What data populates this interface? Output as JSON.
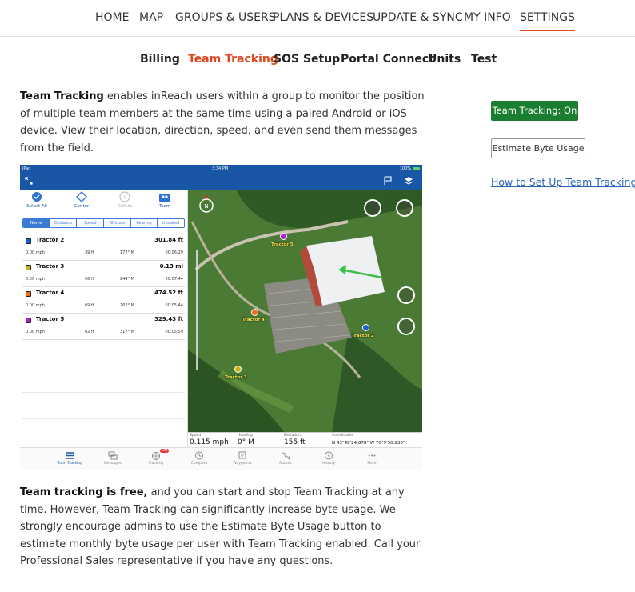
{
  "top_nav": {
    "items": [
      "HOME",
      "MAP",
      "GROUPS & USERS",
      "PLANS & DEVICES",
      "UPDATE & SYNC",
      "MY INFO",
      "SETTINGS"
    ],
    "active": "SETTINGS"
  },
  "sub_nav": {
    "items": [
      "Billing",
      "Team Tracking",
      "SOS Setup",
      "Portal Connect",
      "Units",
      "Test"
    ],
    "active": "Team Tracking"
  },
  "intro": {
    "bold": "Team Tracking",
    "text": " enables inReach users within a group to monitor the position of multiple team members at the same time using a paired Android or iOS device. View their location, direction, speed, and even send them messages from the field."
  },
  "sidebar": {
    "status_button": "Team Tracking: On",
    "estimate_button": "Estimate Byte Usage",
    "help_link": "How to Set Up Team Tracking"
  },
  "app": {
    "status_left": "iPad",
    "status_time": "3:34 PM",
    "status_right": "100%",
    "tools": [
      "Select All",
      "Center",
      "Details",
      "Team"
    ],
    "segments": [
      "Name",
      "Distance",
      "Speed",
      "Altitude",
      "Bearing",
      "Updated"
    ],
    "active_segment": "Name",
    "trackers": [
      {
        "name": "Tractor 2",
        "distance": "301.84 ft",
        "speed": "0.00 mph",
        "altitude": "39 ft",
        "bearing": "177° M",
        "updated": "00:06:29",
        "color": "#1f5fd6"
      },
      {
        "name": "Tractor 3",
        "distance": "0.13 mi",
        "speed": "0.00 mph",
        "altitude": "56 ft",
        "bearing": "244° M",
        "updated": "00:07:44",
        "color": "#c9b21c"
      },
      {
        "name": "Tractor 4",
        "distance": "474.52 ft",
        "speed": "0.00 mph",
        "altitude": "69 ft",
        "bearing": "262° M",
        "updated": "00:05:44",
        "color": "#ef6c1a"
      },
      {
        "name": "Tractor 5",
        "distance": "329.43 ft",
        "speed": "0.00 mph",
        "altitude": "62 ft",
        "bearing": "317° M",
        "updated": "00:05:59",
        "color": "#b620d8"
      }
    ],
    "map_labels": [
      "Tractor 5",
      "Tractor 4",
      "Tractor 2",
      "Tractor 3"
    ],
    "readout": {
      "speed_label": "Speed",
      "speed": "0.115 mph",
      "heading_label": "Heading",
      "heading": "0° M",
      "elevation_label": "Elevation",
      "elevation": "155 ft",
      "coord_label": "Coordinates",
      "coord": "N 43°48'24.878\"  W 70°9'50.230\""
    },
    "tabs": [
      "Team Tracking",
      "Messages",
      "Tracking",
      "Compass",
      "Waypoints",
      "Routes",
      "History",
      "More"
    ],
    "tracking_badge": "ON"
  },
  "outro": {
    "bold": "Team tracking is free,",
    "text": " and you can start and stop Team Tracking at any time. However, Team Tracking can significantly increase byte usage. We strongly encourage admins to use the Estimate Byte Usage button to estimate monthly byte usage per user with Team Tracking enabled. Call your Professional Sales representative if you have any questions."
  },
  "colors": {
    "accent": "#e0481f",
    "green": "#1a7e31",
    "link": "#2a64b5",
    "app_blue": "#1a56a6"
  }
}
